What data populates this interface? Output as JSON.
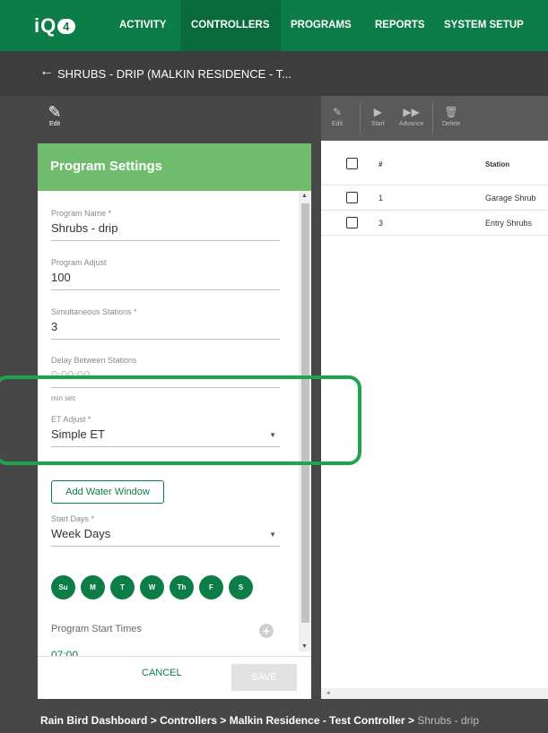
{
  "nav": {
    "logo_text": "iQ",
    "logo_badge": "4",
    "items": [
      "ACTIVITY",
      "CONTROLLERS",
      "PROGRAMS",
      "REPORTS",
      "SYSTEM SETUP"
    ],
    "active": "CONTROLLERS"
  },
  "titlebar": {
    "back_icon": "arrow-left-icon",
    "title": "SHRUBS - DRIP (MALKIN RESIDENCE - T..."
  },
  "edit_left": {
    "icon": "pencil-icon",
    "label": "Edit"
  },
  "panel": {
    "title": "Program Settings",
    "program_name": {
      "label": "Program Name *",
      "value": "Shrubs - drip"
    },
    "program_adjust": {
      "label": "Program Adjust",
      "value": "100"
    },
    "simultaneous": {
      "label": "Simultaneous Stations *",
      "value": "3"
    },
    "delay": {
      "label": "Delay Between Stations",
      "value": "0:00:00",
      "unit": "min sec"
    },
    "et_adjust": {
      "label": "ET Adjust *",
      "value": "Simple ET"
    },
    "water_window_button": "Add Water Window",
    "start_days": {
      "label": "Start Days *",
      "value": "Week Days"
    },
    "days": [
      "Su",
      "M",
      "T",
      "W",
      "Th",
      "F",
      "S"
    ],
    "start_times_label": "Program Start Times",
    "add_time_icon": "plus-circle-icon",
    "start_time": "07:00",
    "cancel": "CANCEL",
    "save": "SAVE"
  },
  "toolbar": [
    {
      "icon": "pencil-icon",
      "label": "Edit"
    },
    {
      "icon": "play-icon",
      "label": "Start"
    },
    {
      "icon": "fast-forward-icon",
      "label": "Advance"
    },
    {
      "icon": "trash-icon",
      "label": "Delete"
    }
  ],
  "table": {
    "headers": {
      "number": "#",
      "station": "Station"
    },
    "rows": [
      {
        "number": "1",
        "station": "Garage Shrub"
      },
      {
        "number": "3",
        "station": "Entry Shrubs"
      }
    ]
  },
  "breadcrumb": {
    "items": [
      "Rain Bird Dashboard",
      "Controllers",
      "Malkin Residence - Test Controller"
    ],
    "separator": ">",
    "current": "Shrubs - drip"
  },
  "colors": {
    "brand": "#0c7d46",
    "panel_header": "#6fbd6c",
    "highlight": "#1fa44e"
  }
}
